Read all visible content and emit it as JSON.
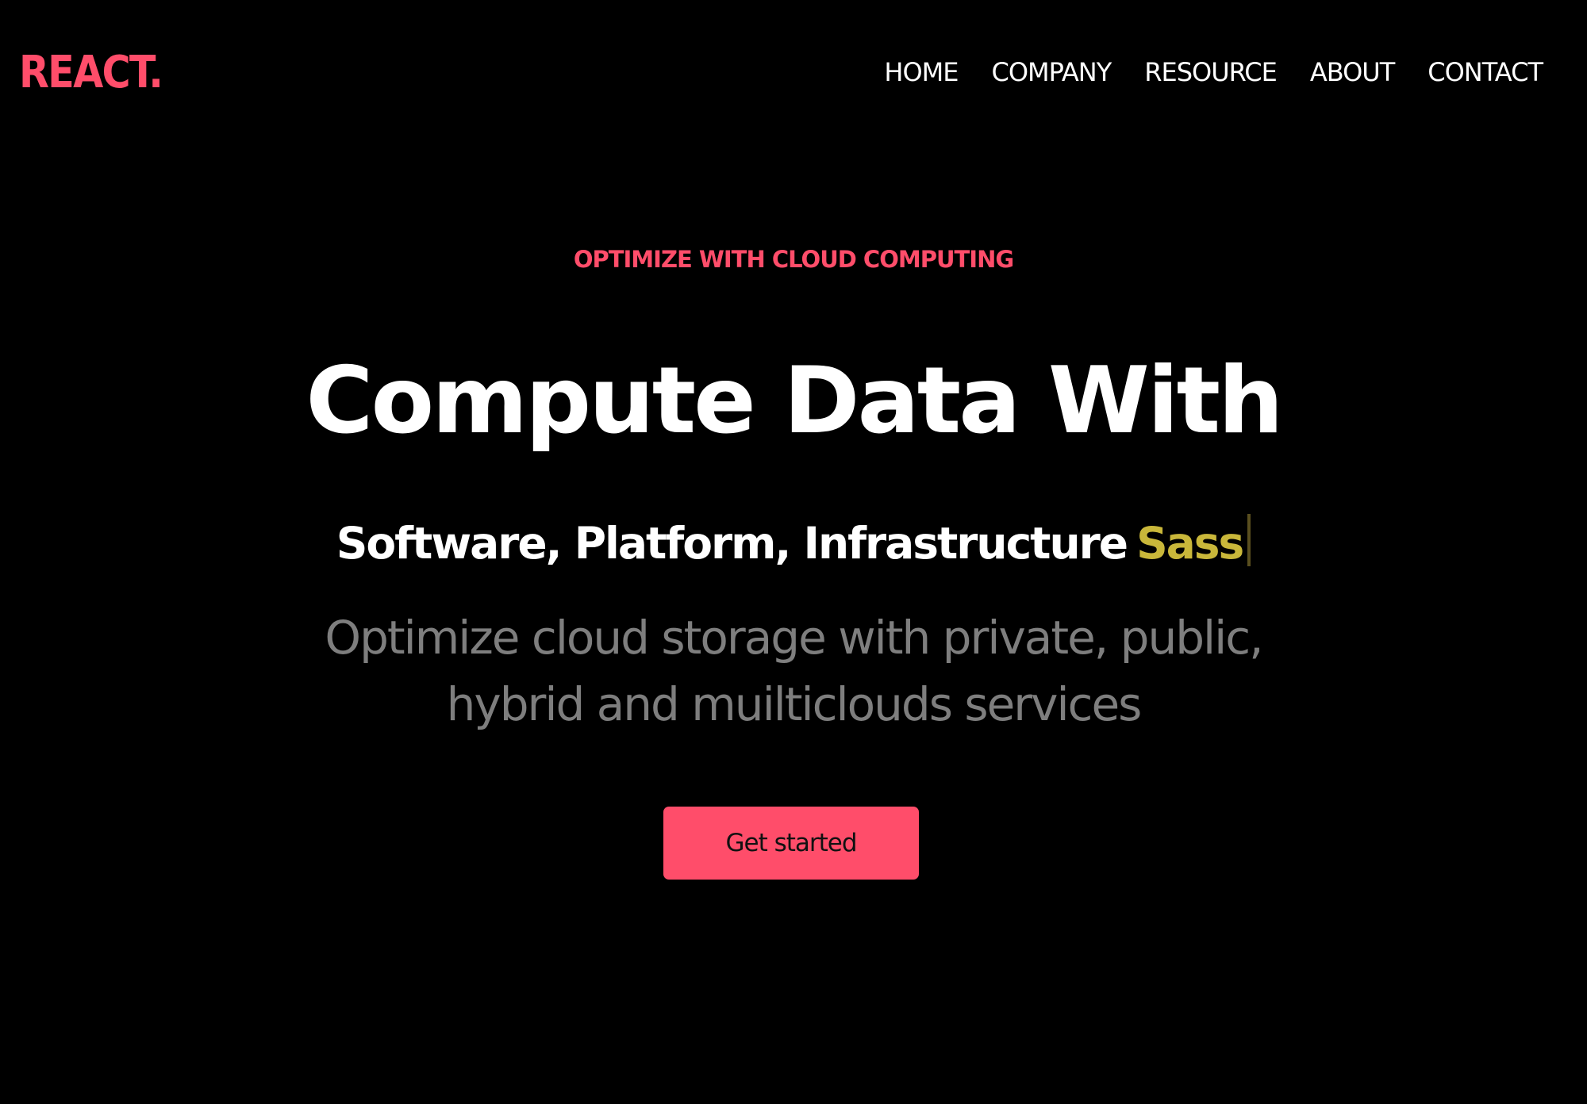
{
  "header": {
    "logo": "REACT.",
    "nav": [
      "HOME",
      "COMPANY",
      "RESOURCE",
      "ABOUT",
      "CONTACT"
    ]
  },
  "hero": {
    "eyebrow": "OPTIMIZE WITH CLOUD COMPUTING",
    "headline": "Compute Data With",
    "typed_static": "Software, Platform, Infrastructure",
    "typed_word": "Sass",
    "description": "Optimize cloud storage with private, public, hybrid and muilticlouds services",
    "cta_label": "Get started"
  },
  "colors": {
    "background": "#000000",
    "accent": "#ff4d6a",
    "typed_word": "#c9b73a",
    "description_text": "#7e7e7e"
  }
}
